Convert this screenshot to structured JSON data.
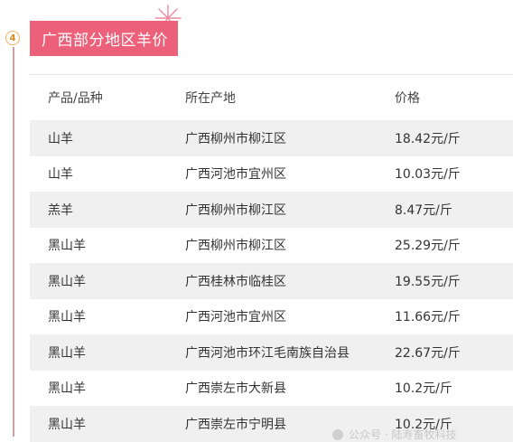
{
  "section": {
    "step_number": "4",
    "title": "广西部分地区羊价"
  },
  "table": {
    "headers": [
      "产品/品种",
      "所在产地",
      "价格"
    ],
    "rows": [
      {
        "product": "山羊",
        "origin": "广西柳州市柳江区",
        "price": "18.42元/斤"
      },
      {
        "product": "山羊",
        "origin": "广西河池市宜州区",
        "price": "10.03元/斤"
      },
      {
        "product": "羔羊",
        "origin": "广西柳州市柳江区",
        "price": "8.47元/斤"
      },
      {
        "product": "黑山羊",
        "origin": "广西柳州市柳江区",
        "price": "25.29元/斤"
      },
      {
        "product": "黑山羊",
        "origin": "广西桂林市临桂区",
        "price": "19.55元/斤"
      },
      {
        "product": "黑山羊",
        "origin": "广西河池市宜州区",
        "price": "11.66元/斤"
      },
      {
        "product": "黑山羊",
        "origin": "广西河池市环江毛南族自治县",
        "price": "22.67元/斤"
      },
      {
        "product": "黑山羊",
        "origin": "广西崇左市大新县",
        "price": "10.2元/斤"
      },
      {
        "product": "黑山羊",
        "origin": "广西崇左市宁明县",
        "price": "10.2元/斤"
      }
    ]
  },
  "watermark": {
    "text": "公众号 · 陆寿畜牧科技"
  },
  "colors": {
    "title_bg": "#ec6079",
    "badge_border": "#f0b35a",
    "alt_row_bg": "#f0f0f0"
  }
}
